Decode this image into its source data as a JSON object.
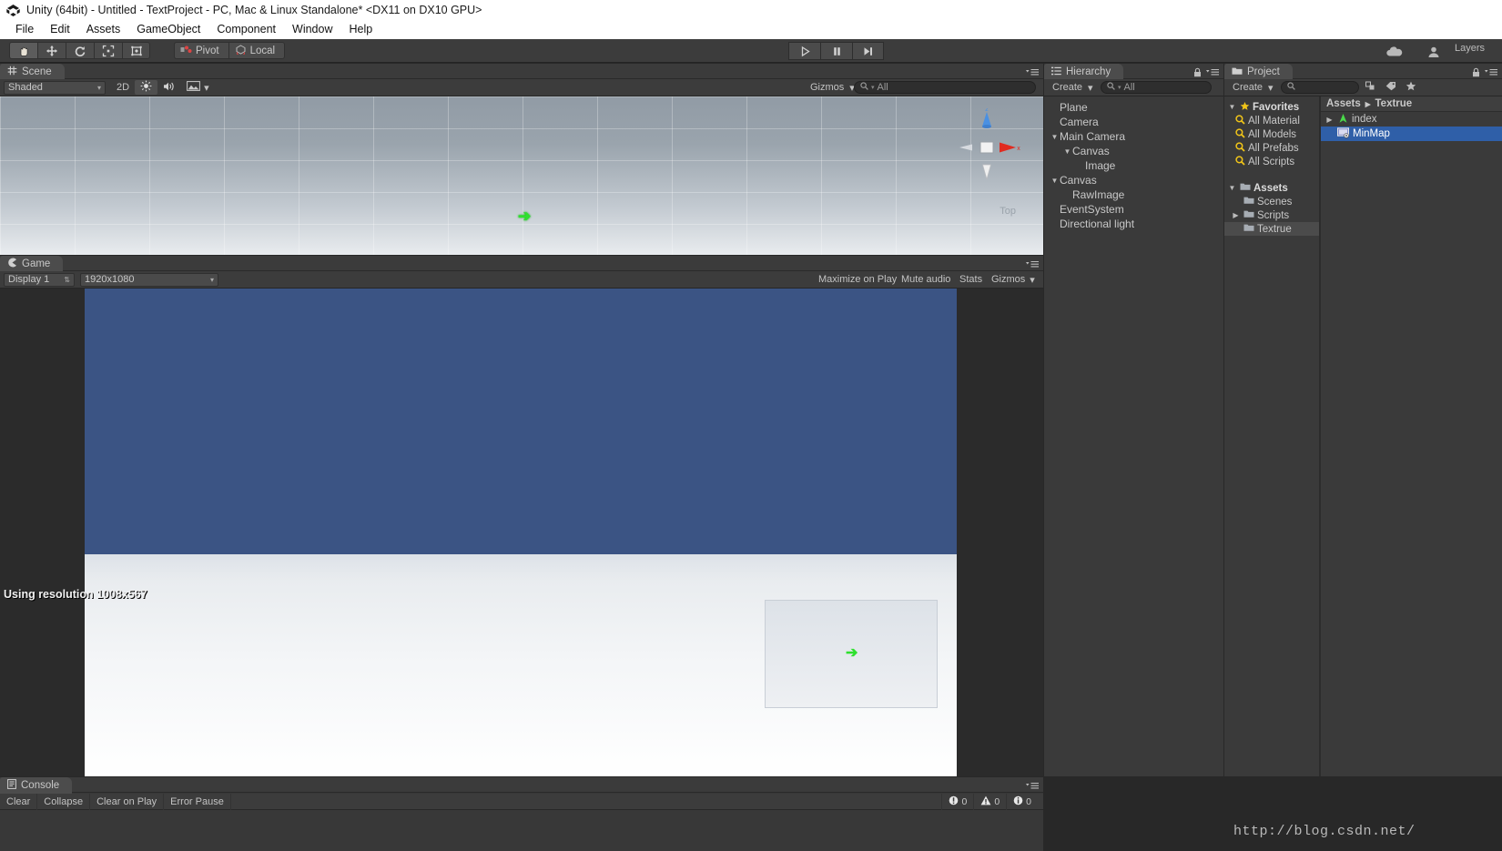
{
  "window": {
    "title": "Unity (64bit) - Untitled - TextProject - PC, Mac & Linux Standalone* <DX11 on DX10 GPU>",
    "logo_icon": "unity-logo-icon"
  },
  "menu": {
    "items": [
      {
        "label": "File"
      },
      {
        "label": "Edit"
      },
      {
        "label": "Assets"
      },
      {
        "label": "GameObject"
      },
      {
        "label": "Component"
      },
      {
        "label": "Window"
      },
      {
        "label": "Help"
      }
    ]
  },
  "toolbar": {
    "tools": [
      {
        "name": "hand-tool",
        "icon": "hand-icon",
        "active": true
      },
      {
        "name": "move-tool",
        "icon": "move-arrows-icon",
        "active": false
      },
      {
        "name": "rotate-tool",
        "icon": "rotate-icon",
        "active": false
      },
      {
        "name": "scale-tool",
        "icon": "scale-icon",
        "active": false
      },
      {
        "name": "rect-tool",
        "icon": "rect-transform-icon",
        "active": false
      }
    ],
    "pivot_label": "Pivot",
    "pivot_icon": "pivot-icon",
    "local_label": "Local",
    "local_icon": "local-rotation-icon",
    "play_icon": "play-icon",
    "pause_icon": "pause-icon",
    "step_icon": "step-icon",
    "cloud_icon": "cloud-icon",
    "account_icon": "account-icon",
    "layers_label": "Layers"
  },
  "scene": {
    "tab_label": "Scene",
    "tab_icon": "scene-grid-icon",
    "shading_mode": "Shaded",
    "mode_2d": "2D",
    "lighting_icon": "lighting-sun-icon",
    "audio_icon": "audio-speaker-icon",
    "effects_icon": "effects-image-icon",
    "gizmos_label": "Gizmos",
    "search_value": "All",
    "search_icon": "search-icon",
    "gizmo_axis_x": "x",
    "gizmo_axis_z": "z",
    "gizmo_view_label": "Top",
    "avatar_icon": "player-arrow-icon"
  },
  "game": {
    "tab_label": "Game",
    "tab_icon": "game-pacman-icon",
    "display": "Display 1",
    "resolution": "1920x1080",
    "maximize_label": "Maximize on Play",
    "mute_label": "Mute audio",
    "stats_label": "Stats",
    "gizmos_label": "Gizmos",
    "resolution_overlay": "Using resolution 1008x567",
    "minimap_arrow_icon": "player-arrow-icon"
  },
  "hierarchy": {
    "tab_label": "Hierarchy",
    "tab_icon": "hierarchy-icon",
    "create_label": "Create",
    "search_value": "All",
    "search_icon": "search-icon",
    "lock_icon": "lock-icon",
    "menu_icon": "panel-menu-icon",
    "items": [
      {
        "label": "Plane",
        "depth": 1,
        "expander": "none"
      },
      {
        "label": "Camera",
        "depth": 1,
        "expander": "none"
      },
      {
        "label": "Main Camera",
        "depth": 1,
        "expander": "down"
      },
      {
        "label": "Canvas",
        "depth": 2,
        "expander": "down"
      },
      {
        "label": "Image",
        "depth": 3,
        "expander": "none"
      },
      {
        "label": "Canvas",
        "depth": 1,
        "expander": "down"
      },
      {
        "label": "RawImage",
        "depth": 2,
        "expander": "none"
      },
      {
        "label": "EventSystem",
        "depth": 1,
        "expander": "none"
      },
      {
        "label": "Directional light",
        "depth": 1,
        "expander": "none"
      }
    ]
  },
  "project": {
    "tab_label": "Project",
    "tab_icon": "folder-icon",
    "create_label": "Create",
    "search_value": "",
    "search_placeholder": "",
    "search_icon": "search-icon",
    "filter_type_icon": "filter-type-icon",
    "filter_label_icon": "filter-label-icon",
    "favorite_icon": "star-icon",
    "lock_icon": "lock-icon",
    "menu_icon": "panel-menu-icon",
    "favorites_label": "Favorites",
    "favorites": [
      {
        "label": "All Material",
        "icon": "search-saved-icon"
      },
      {
        "label": "All Models",
        "icon": "search-saved-icon"
      },
      {
        "label": "All Prefabs",
        "icon": "search-saved-icon"
      },
      {
        "label": "All Scripts",
        "icon": "search-saved-icon"
      }
    ],
    "assets_label": "Assets",
    "assets_tree": [
      {
        "label": "Scenes",
        "expander": "none"
      },
      {
        "label": "Scripts",
        "expander": "right"
      },
      {
        "label": "Textrue",
        "expander": "none",
        "selected_folder": true
      }
    ],
    "breadcrumb": [
      "Assets",
      "Textrue"
    ],
    "breadcrumb_sep": "▸",
    "content": [
      {
        "label": "index",
        "icon": "prefab-arrow-icon",
        "expander": "right",
        "selected": false
      },
      {
        "label": "MinMap",
        "icon": "render-texture-icon",
        "expander": "none",
        "selected": true
      }
    ]
  },
  "console": {
    "tab_label": "Console",
    "tab_icon": "console-icon",
    "clear_label": "Clear",
    "collapse_label": "Collapse",
    "clear_on_play_label": "Clear on Play",
    "error_pause_label": "Error Pause",
    "counts": [
      {
        "icon": "error-icon",
        "value": "0"
      },
      {
        "icon": "warning-icon",
        "value": "0"
      },
      {
        "icon": "info-icon",
        "value": "0"
      }
    ]
  },
  "watermark": {
    "text": "http://blog.csdn.net/"
  },
  "colors": {
    "selection_blue": "#2f5fa8",
    "panel_bg": "#383838",
    "toolbar_bg": "#3c3c3c",
    "player_green": "#2ee02e",
    "game_sky": "#3b5484"
  }
}
